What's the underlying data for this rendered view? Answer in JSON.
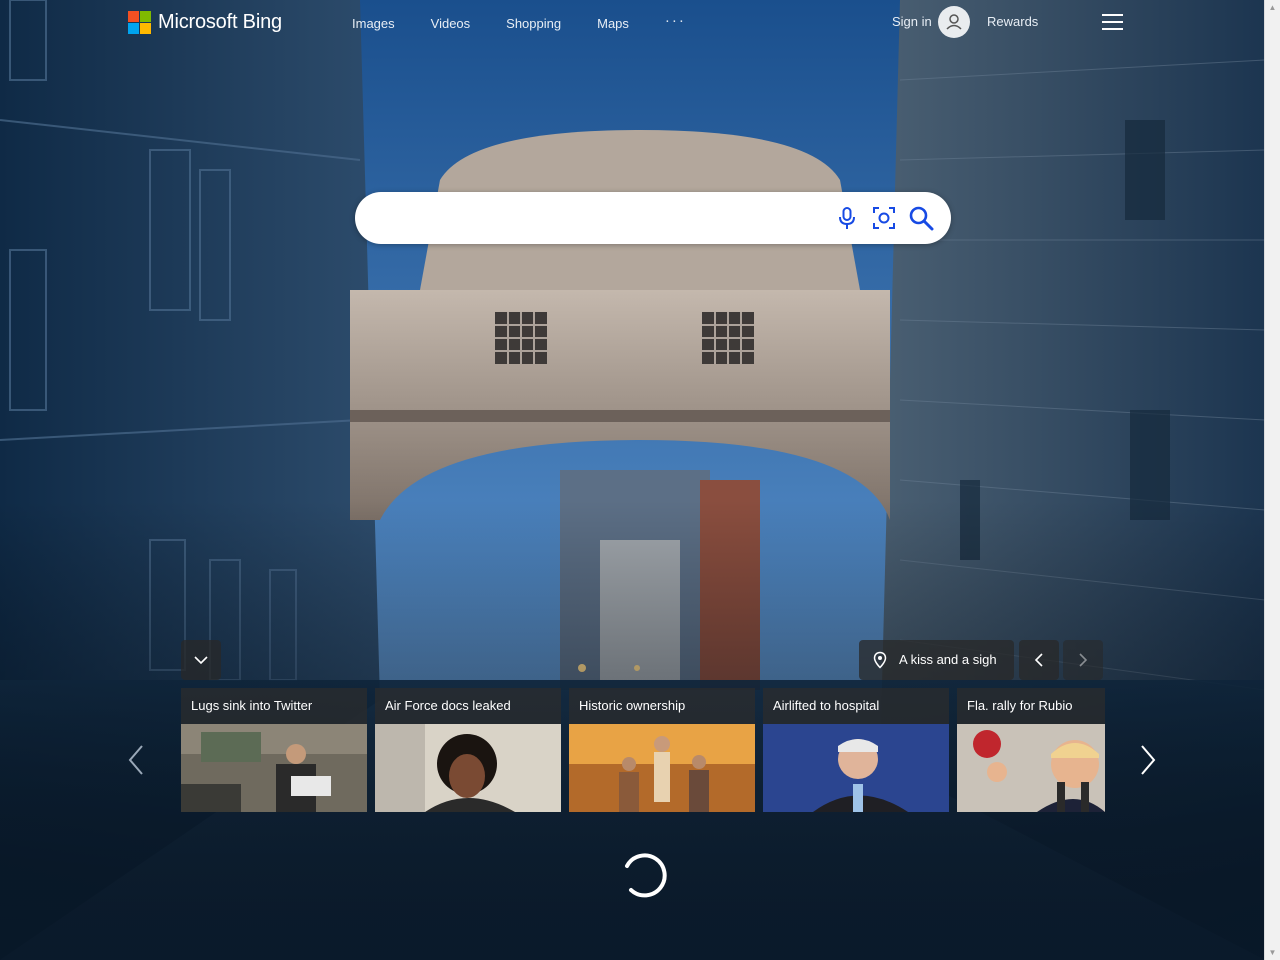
{
  "header": {
    "logo_text": "Microsoft Bing",
    "nav": [
      "Images",
      "Videos",
      "Shopping",
      "Maps"
    ],
    "more": "···",
    "signin": "Sign in",
    "rewards": "Rewards"
  },
  "search": {
    "value": "",
    "placeholder": ""
  },
  "location": {
    "label": "A kiss and a sigh"
  },
  "cards": [
    {
      "title": "Lugs sink into Twitter"
    },
    {
      "title": "Air Force docs leaked"
    },
    {
      "title": "Historic ownership"
    },
    {
      "title": "Airlifted to hospital"
    },
    {
      "title": "Fla. rally for Rubio"
    }
  ],
  "colors": {
    "logo_red": "#f25022",
    "logo_green": "#7fba00",
    "logo_blue": "#00a4ef",
    "logo_yellow": "#ffb900",
    "search_icon_blue": "#174ae4"
  }
}
